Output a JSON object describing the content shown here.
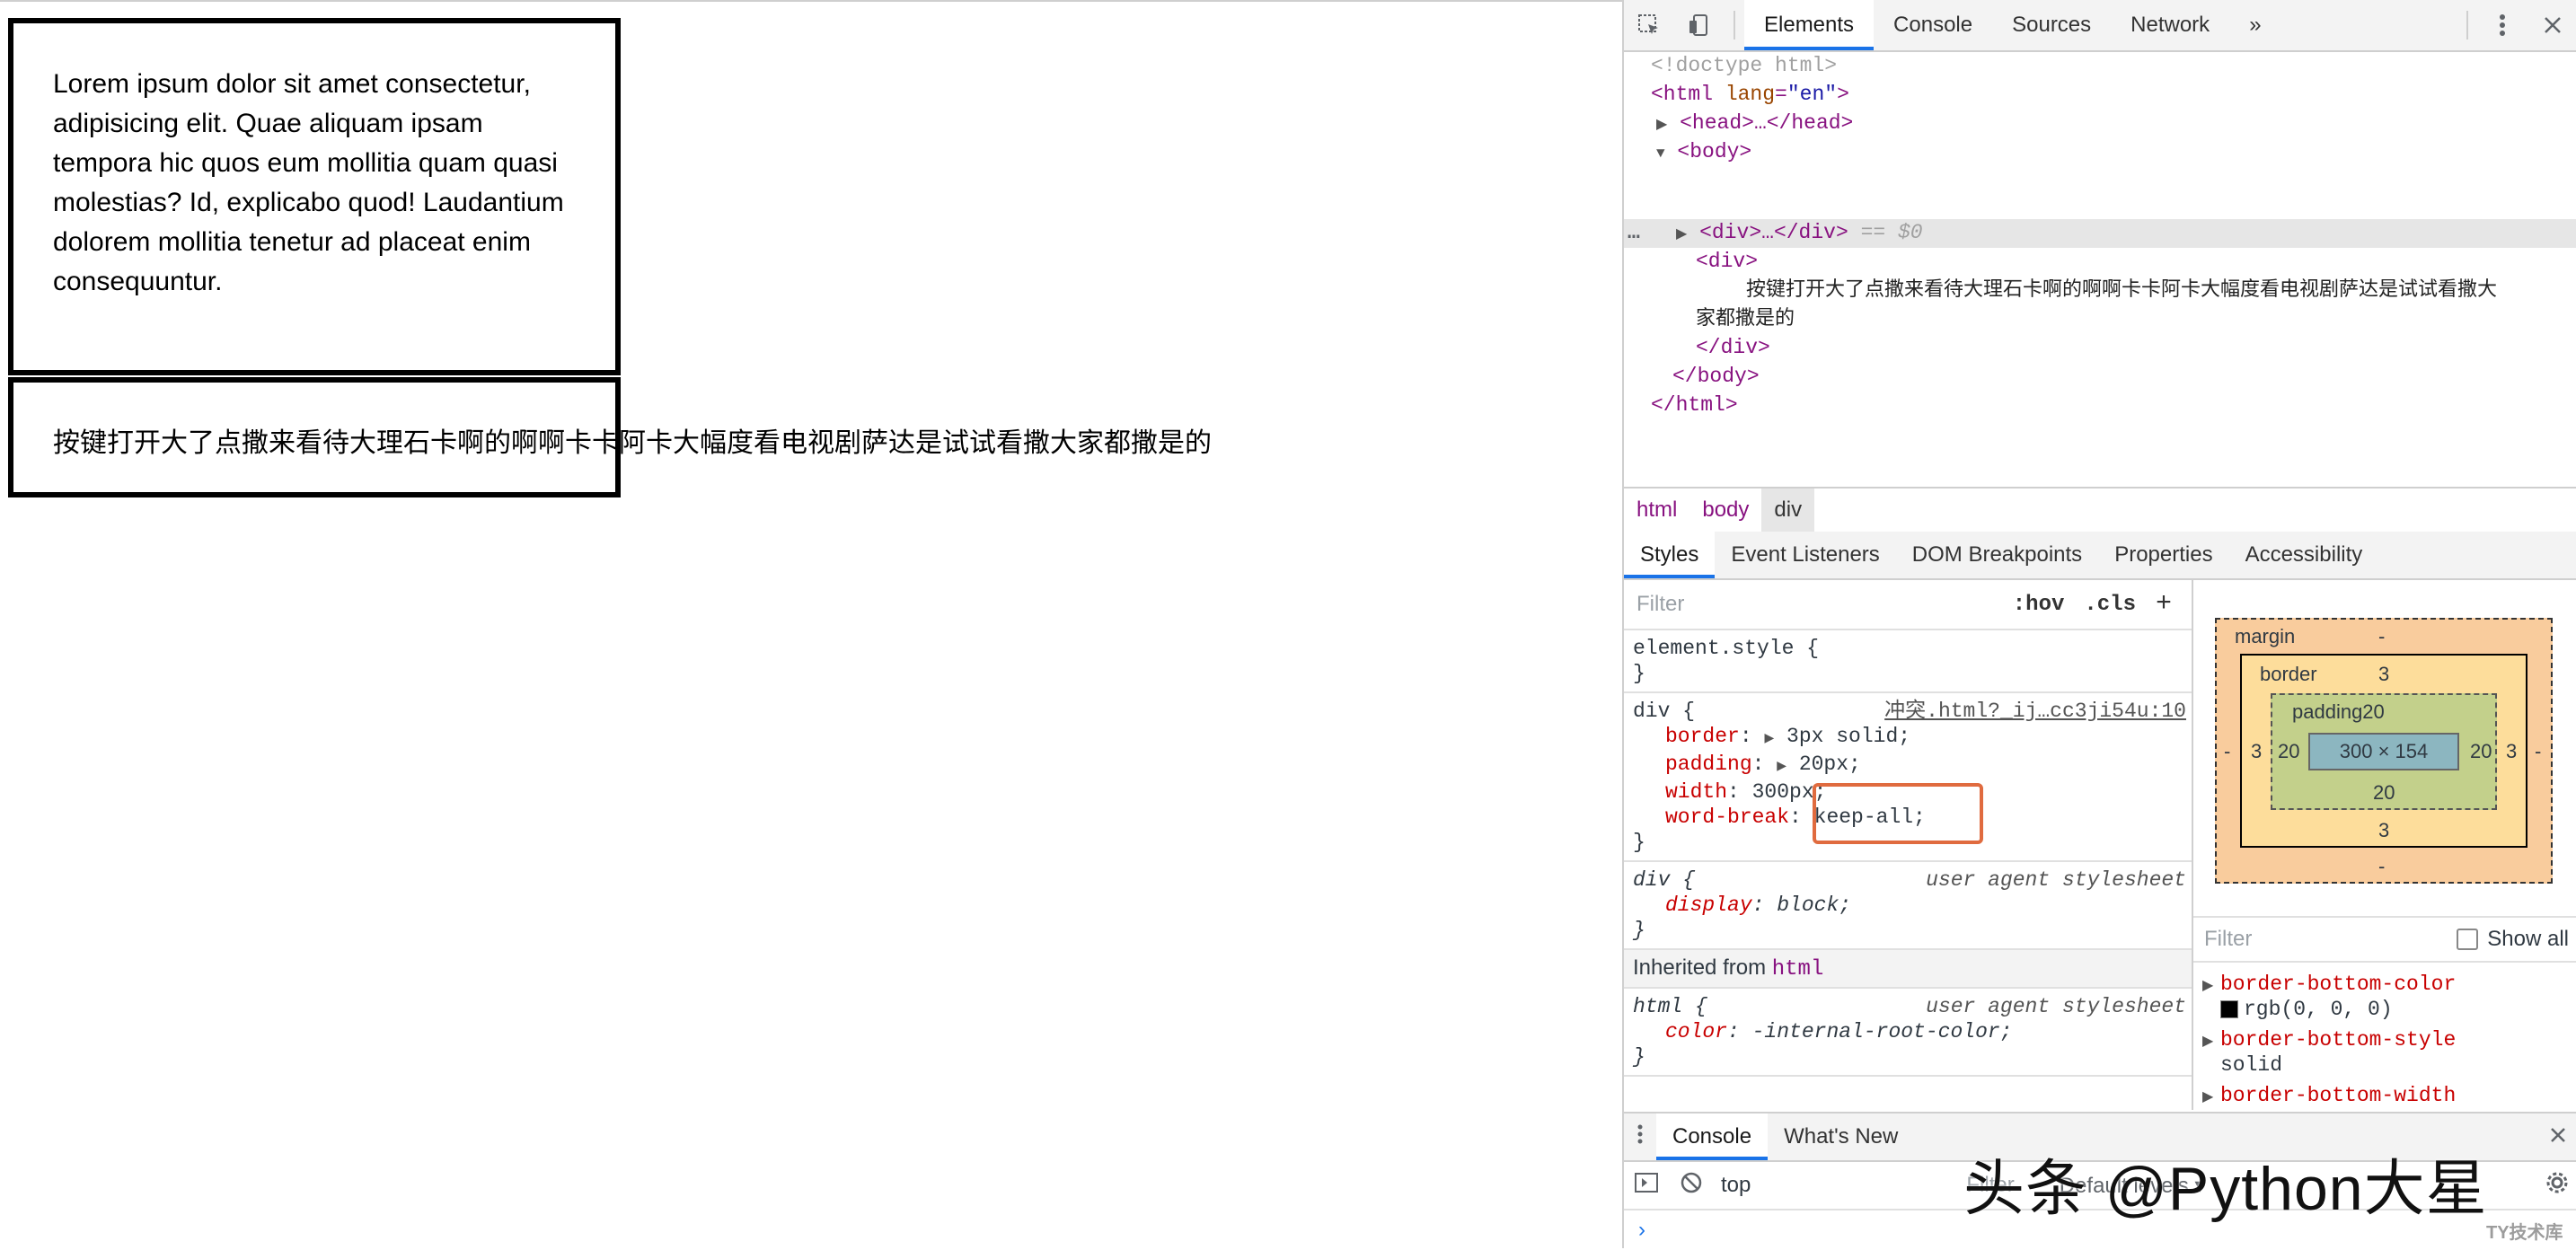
{
  "page": {
    "box1_text": "Lorem ipsum dolor sit amet consectetur, adipisicing elit. Quae aliquam ipsam tempora hic quos eum mollitia quam quasi molestias? Id, explicabo quod! Laudantium dolorem mollitia tenetur ad placeat enim consequuntur.",
    "box2_text": "按键打开大了点撒来看待大理石卡啊的啊啊卡卡阿卡大幅度看电视剧萨达是试试看撒大家都撒是的"
  },
  "toolbar": {
    "tabs": [
      "Elements",
      "Console",
      "Sources",
      "Network"
    ],
    "more": "»"
  },
  "dom": {
    "doctype": "<!doctype html>",
    "html_open": "<html",
    "lang_attr": "lang",
    "lang_val": "\"en\"",
    "gt": ">",
    "head": "<head>…</head>",
    "body_open": "<body>",
    "div_collapsed": "<div>…</div>",
    "eq": "== $0",
    "dots": "…",
    "div_open": "<div>",
    "div_text_1": "按键打开大了点撒来看待大理石卡啊的啊啊卡卡阿卡大幅度看电视剧萨达是试试看撒大",
    "div_text_2": "家都撒是的",
    "div_close": "</div>",
    "body_close": "</body>",
    "html_close": "</html>"
  },
  "breadcrumbs": [
    "html",
    "body",
    "div"
  ],
  "subtabs": [
    "Styles",
    "Event Listeners",
    "DOM Breakpoints",
    "Properties",
    "Accessibility"
  ],
  "styles": {
    "filter_placeholder": "Filter",
    "hov": ":hov",
    "cls": ".cls",
    "add": "+",
    "element_style": "element.style {",
    "close": "}",
    "div_selector": "div {",
    "div_source": "冲突.html?_ij…cc3ji54u:10",
    "props": [
      {
        "name": "border",
        "value": "3px solid;"
      },
      {
        "name": "padding",
        "value": "20px;"
      },
      {
        "name": "width",
        "value": "300px;"
      },
      {
        "name": "word-break",
        "value": "keep-all;"
      }
    ],
    "ua_div": "div {",
    "ua_label": "user agent stylesheet",
    "display_name": "display",
    "display_value": "block;",
    "inherited_label": "Inherited from",
    "inherited_tag": "html",
    "html_selector": "html {",
    "color_name": "color",
    "color_value": "-internal-root-color;"
  },
  "boxmodel": {
    "margin_label": "margin",
    "margin_top": "-",
    "margin_bottom": "-",
    "margin_left": "-",
    "margin_right": "-",
    "border_label": "border",
    "border_top": "3",
    "border_bottom": "3",
    "border_left": "3",
    "border_right": "3",
    "padding_label": "padding20",
    "padding_bottom": "20",
    "padding_left": "20",
    "padding_right": "20",
    "content": "300 × 154"
  },
  "computed": {
    "filter_placeholder": "Filter",
    "show_all": "Show all",
    "props": [
      {
        "name": "border-bottom-color",
        "value": "rgb(0, 0, 0)"
      },
      {
        "name": "border-bottom-style",
        "value": "solid"
      },
      {
        "name": "border-bottom-width",
        "value": ""
      }
    ]
  },
  "drawer": {
    "tabs": [
      "Console",
      "What's New"
    ],
    "context": "top",
    "filter": "Filter",
    "levels": "Default levels ▾",
    "prompt": "›"
  },
  "watermark": {
    "main": "头条 @Python大星",
    "small": "TY技术库"
  },
  "colors": {
    "accent": "#1a73e8",
    "highlight_box": "#e06b3f",
    "tag": "#881280",
    "prop_name": "#c80000"
  }
}
